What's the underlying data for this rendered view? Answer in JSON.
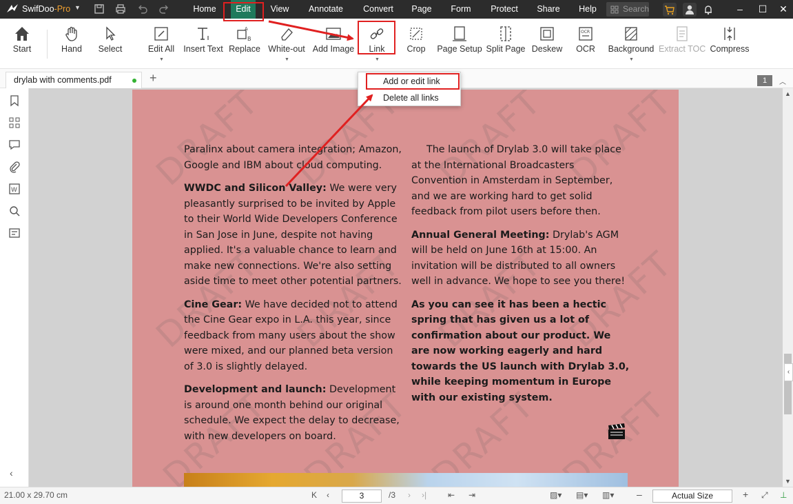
{
  "app": {
    "name": "SwifDoo",
    "edition": "-Pro",
    "menus": [
      "Home",
      "Edit",
      "View",
      "Annotate",
      "Convert",
      "Page",
      "Form",
      "Protect",
      "Share",
      "Help"
    ],
    "active_menu": "Edit",
    "search_placeholder": "Search"
  },
  "toolbar": {
    "start": "Start",
    "hand": "Hand",
    "select": "Select",
    "edit_all": "Edit All",
    "insert_text": "Insert Text",
    "replace": "Replace",
    "white_out": "White-out",
    "add_image": "Add Image",
    "link": "Link",
    "crop": "Crop",
    "page_setup": "Page Setup",
    "split_page": "Split Page",
    "deskew": "Deskew",
    "ocr": "OCR",
    "background": "Background",
    "extract_toc": "Extract TOC",
    "compress": "Compress"
  },
  "tab": {
    "filename": "drylab with comments.pdf",
    "page_badge": "1"
  },
  "link_menu": {
    "items": [
      "Add or edit link",
      "Delete all links"
    ]
  },
  "document": {
    "watermark": "DRAFT",
    "left_column": [
      {
        "heading": "",
        "text": "Paralinx about camera integration; Amazon, Google and IBM about cloud computing."
      },
      {
        "heading": "WWDC and Silicon Valley:",
        "text": " We were very pleasantly surprised to be invited by Apple to their World Wide Developers Conference in San Jose in June, despite not having applied. It's a valuable chance to learn and make new connections. We're also setting aside time to meet other potential partners."
      },
      {
        "heading": "Cine Gear:",
        "text": " We have decided not to attend the Cine Gear expo in L.A. this year, since feedback from many users about the show were mixed, and our planned beta version of 3.0 is slightly delayed."
      },
      {
        "heading": "Development and launch:",
        "text": " Development is around one month behind our original schedule. We expect the delay to decrease, with new developers on board."
      }
    ],
    "right_column": [
      {
        "heading": "",
        "text": "The launch of Drylab 3.0 will take place at the International Broadcasters Convention in Amsterdam in September, and we are working hard to get solid feedback from pilot users before then."
      },
      {
        "heading": "Annual General Meeting:",
        "text": " Drylab's AGM will be held on June 16th at 15:00. An invitation will be distributed to all owners well in advance. We hope to see you there!"
      },
      {
        "heading": "",
        "text": "As you can see it has been a hectic spring that has given us a lot of confirmation about our product. We are now working eagerly and hard towards the US launch with Drylab 3.0, while keeping momentum in Europe with our existing system."
      }
    ]
  },
  "status": {
    "page_size": "21.00 x 29.70 cm",
    "current_page": "3",
    "total_pages": "/3",
    "zoom": "Actual Size"
  },
  "colors": {
    "titlebar": "#2c2c2c",
    "active_menu": "#1f7a5c",
    "page_background": "#d99292",
    "annotation_red": "#e02020"
  }
}
